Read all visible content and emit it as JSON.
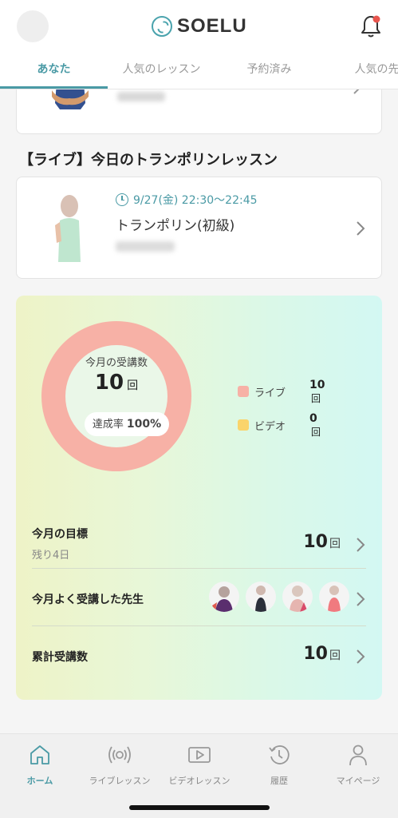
{
  "app": {
    "brand": "SOELU"
  },
  "tabs": [
    {
      "label": "あなた",
      "active": true
    },
    {
      "label": "人気のレッスン",
      "active": false
    },
    {
      "label": "予約済み",
      "active": false
    },
    {
      "label": "人気の先",
      "active": false
    }
  ],
  "live_section": {
    "title": "【ライブ】今日のトランポリンレッスン",
    "lesson": {
      "datetime": "9/27(金) 22:30〜22:45",
      "name": "トランポリン(初級)"
    }
  },
  "stats": {
    "month_label": "今月の受講数",
    "month_count": "10",
    "unit": "回",
    "rate_label": "達成率",
    "rate_value": "100%",
    "breakdown": [
      {
        "label": "ライブ",
        "value": "10",
        "color": "#f7b1a6",
        "share": 1.0
      },
      {
        "label": "ビデオ",
        "value": "0",
        "color": "#fad46b",
        "share": 0.0
      }
    ],
    "goal": {
      "title": "今月の目標",
      "sub": "残り4日",
      "value": "10"
    },
    "teachers": {
      "title": "今月よく受講した先生"
    },
    "total": {
      "title": "累計受講数",
      "value": "10"
    }
  },
  "nav": [
    {
      "label": "ホーム",
      "icon": "home-icon",
      "active": true
    },
    {
      "label": "ライブレッスン",
      "icon": "live-broadcast-icon",
      "active": false
    },
    {
      "label": "ビデオレッスン",
      "icon": "video-play-icon",
      "active": false
    },
    {
      "label": "履歴",
      "icon": "history-icon",
      "active": false
    },
    {
      "label": "マイページ",
      "icon": "person-icon",
      "active": false
    }
  ],
  "colors": {
    "accent": "#4a9aa5",
    "notification": "#e8554e"
  }
}
